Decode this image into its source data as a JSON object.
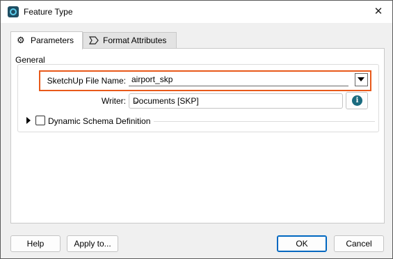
{
  "window": {
    "title": "Feature Type",
    "close_glyph": "✕"
  },
  "tabs": [
    {
      "label": "Parameters",
      "icon": "gear-icon",
      "active": true
    },
    {
      "label": "Format Attributes",
      "icon": "chevron-tag-icon",
      "active": false
    }
  ],
  "group": {
    "label": "General"
  },
  "fields": {
    "file_name": {
      "label": "SketchUp File Name:",
      "value": "airport_skp"
    },
    "writer": {
      "label": "Writer:",
      "value": "Documents [SKP]"
    }
  },
  "dynamic_schema": {
    "label": "Dynamic Schema Definition",
    "checked": false
  },
  "buttons": {
    "help": "Help",
    "apply": "Apply to...",
    "ok": "OK",
    "cancel": "Cancel"
  },
  "colors": {
    "highlight": "#e8591a",
    "accent": "#0067c0",
    "info": "#1a6b7f"
  }
}
